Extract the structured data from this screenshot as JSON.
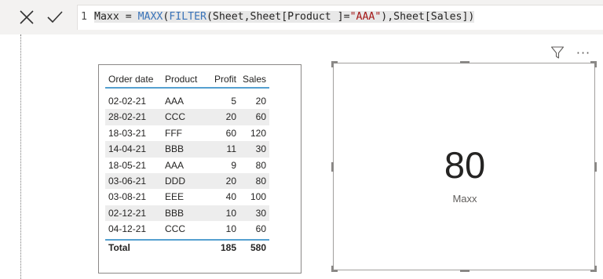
{
  "formula_bar": {
    "line_number": "1",
    "measure_name": "Maxx",
    "equals": " = ",
    "fn_maxx": "MAXX",
    "open1": "(",
    "fn_filter": "FILTER",
    "args1": "(Sheet,Sheet[Product ]=",
    "string_literal": "\"AAA\"",
    "args2": "),Sheet[Sales])",
    "cancel_icon": "close-icon",
    "commit_icon": "checkmark-icon"
  },
  "table": {
    "headers": {
      "order_date": "Order date",
      "product": "Product",
      "profit": "Profit",
      "sales": "Sales"
    },
    "rows": [
      {
        "order_date": "02-02-21",
        "product": "AAA",
        "profit": "5",
        "sales": "20"
      },
      {
        "order_date": "28-02-21",
        "product": "CCC",
        "profit": "20",
        "sales": "60"
      },
      {
        "order_date": "18-03-21",
        "product": "FFF",
        "profit": "60",
        "sales": "120"
      },
      {
        "order_date": "14-04-21",
        "product": "BBB",
        "profit": "11",
        "sales": "30"
      },
      {
        "order_date": "18-05-21",
        "product": "AAA",
        "profit": "9",
        "sales": "80"
      },
      {
        "order_date": "03-06-21",
        "product": "DDD",
        "profit": "20",
        "sales": "80"
      },
      {
        "order_date": "03-08-21",
        "product": "EEE",
        "profit": "40",
        "sales": "100"
      },
      {
        "order_date": "02-12-21",
        "product": "BBB",
        "profit": "10",
        "sales": "30"
      },
      {
        "order_date": "04-12-21",
        "product": "CCC",
        "profit": "10",
        "sales": "60"
      }
    ],
    "total": {
      "label": "Total",
      "profit": "185",
      "sales": "580"
    },
    "band_color": "#ededed",
    "accent_color": "#55a0d0"
  },
  "card": {
    "value": "80",
    "label": "Maxx"
  },
  "visual_header": {
    "filter_icon": "filter-icon",
    "more_label": "···"
  }
}
